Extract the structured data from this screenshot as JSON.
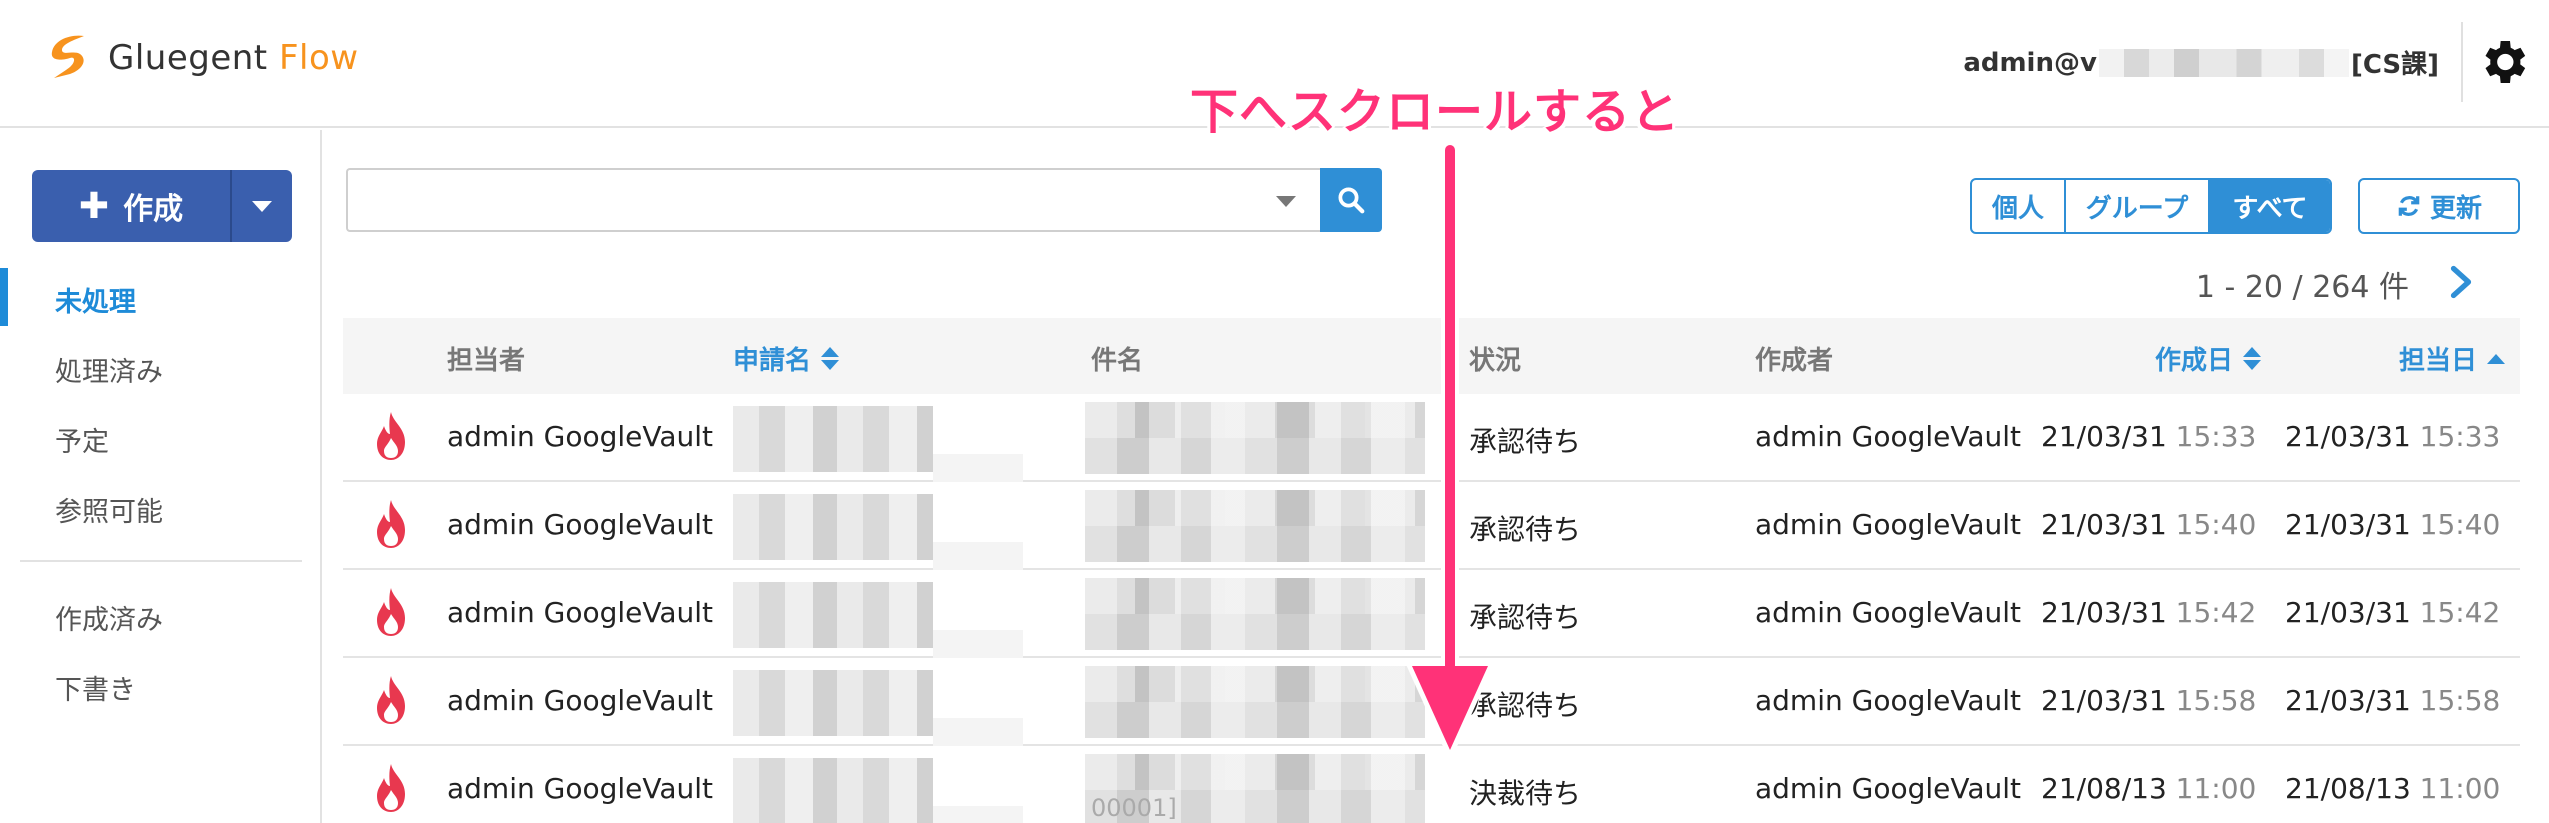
{
  "header": {
    "logo_word1": "Gluegent",
    "logo_word2": "Flow",
    "user_prefix": "admin@v",
    "user_suffix": "[CS課]",
    "settings_icon": "gear-icon"
  },
  "sidebar": {
    "create_label": "作成",
    "create_icon": "plus-icon",
    "items": [
      {
        "label": "未処理",
        "active": true
      },
      {
        "label": "処理済み",
        "active": false
      },
      {
        "label": "予定",
        "active": false
      },
      {
        "label": "参照可能",
        "active": false
      },
      {
        "label": "作成済み",
        "active": false
      },
      {
        "label": "下書き",
        "active": false
      }
    ]
  },
  "toolbar": {
    "filter_individual": "個人",
    "filter_group": "グループ",
    "filter_all": "すべて",
    "refresh_label": "更新",
    "pager_text": "1 - 20 / 264 件"
  },
  "table": {
    "columns": {
      "assignee": "担当者",
      "request_name": "申請名",
      "subject": "件名",
      "status": "状況",
      "creator": "作成者",
      "created": "作成日",
      "assigned": "担当日"
    },
    "rows": [
      {
        "assignee": "admin GoogleVault",
        "subject_tail": "",
        "status": "承認待ち",
        "creator": "admin GoogleVault",
        "created_date": "21/03/31",
        "created_time": "15:33",
        "assigned_date": "21/03/31",
        "assigned_time": "15:33"
      },
      {
        "assignee": "admin GoogleVault",
        "subject_tail": "",
        "status": "承認待ち",
        "creator": "admin GoogleVault",
        "created_date": "21/03/31",
        "created_time": "15:40",
        "assigned_date": "21/03/31",
        "assigned_time": "15:40"
      },
      {
        "assignee": "admin GoogleVault",
        "subject_tail": "",
        "status": "承認待ち",
        "creator": "admin GoogleVault",
        "created_date": "21/03/31",
        "created_time": "15:42",
        "assigned_date": "21/03/31",
        "assigned_time": "15:42"
      },
      {
        "assignee": "admin GoogleVault",
        "subject_tail": "",
        "status": "承認待ち",
        "creator": "admin GoogleVault",
        "created_date": "21/03/31",
        "created_time": "15:58",
        "assigned_date": "21/03/31",
        "assigned_time": "15:58"
      },
      {
        "assignee": "admin GoogleVault",
        "subject_tail": "00001]",
        "status": "決裁待ち",
        "creator": "admin GoogleVault",
        "created_date": "21/08/13",
        "created_time": "11:00",
        "assigned_date": "21/08/13",
        "assigned_time": "11:00"
      }
    ]
  },
  "annotation": {
    "text": "下へスクロールすると",
    "color": "#ff3278"
  },
  "colors": {
    "primary": "#2f8fd6",
    "create_button": "#3a5fae",
    "logo_orange": "#f7931e",
    "flame_red": "#e8384f"
  }
}
